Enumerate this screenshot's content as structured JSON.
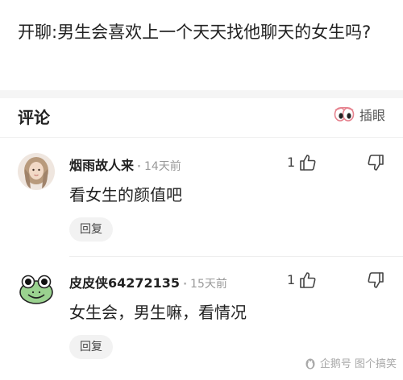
{
  "question": {
    "text": "开聊:男生会喜欢上一个天天找他聊天的女生吗?"
  },
  "comments_header": {
    "title": "评论",
    "insert_label": "插眼"
  },
  "comments": [
    {
      "username": "烟雨故人来",
      "time": "14天前",
      "like_count": "1",
      "body": "看女生的颜值吧",
      "reply_label": "回复"
    },
    {
      "username": "皮皮侠64272135",
      "time": "15天前",
      "like_count": "1",
      "body": "女生会，男生嘛，看情况",
      "reply_label": "回复"
    }
  ],
  "watermark": {
    "text": "企鹅号 图个搞笑"
  },
  "icons": {
    "insert": "eyes-icon",
    "like": "thumbs-up-icon",
    "dislike": "thumbs-down-icon",
    "watermark": "penguin-icon"
  }
}
